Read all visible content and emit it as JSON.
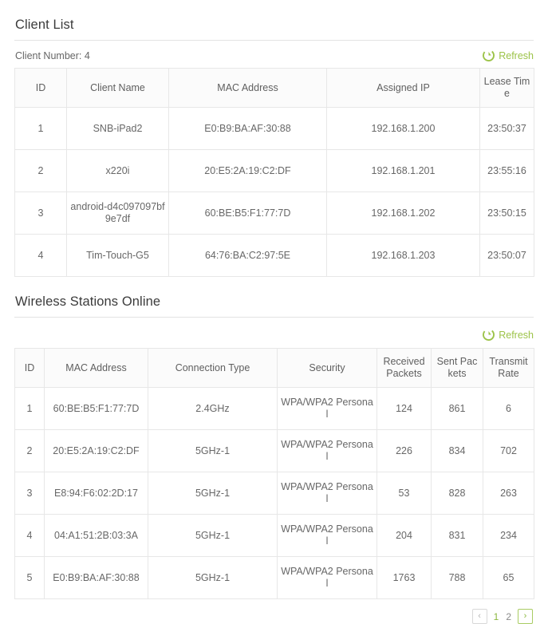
{
  "theme": {
    "accent_green": "#9cc348",
    "border_gray": "#e7e7e7",
    "header_bg": "#fbfbfb",
    "text_gray": "#676767"
  },
  "client_list": {
    "title": "Client List",
    "count_label": "Client Number: 4",
    "refresh_label": "Refresh",
    "refresh_icon": "refresh-circle-arrow-icon",
    "columns": [
      "ID",
      "Client Name",
      "MAC Address",
      "Assigned IP",
      "Lease Time"
    ],
    "rows": [
      [
        "1",
        "SNB-iPad2",
        "E0:B9:BA:AF:30:88",
        "192.168.1.200",
        "23:50:37"
      ],
      [
        "2",
        "x220i",
        "20:E5:2A:19:C2:DF",
        "192.168.1.201",
        "23:55:16"
      ],
      [
        "3",
        "android-d4c097097bf9e7df",
        "60:BE:B5:F1:77:7D",
        "192.168.1.202",
        "23:50:15"
      ],
      [
        "4",
        "Tim-Touch-G5",
        "64:76:BA:C2:97:5E",
        "192.168.1.203",
        "23:50:07"
      ]
    ]
  },
  "wireless_stations": {
    "title": "Wireless Stations Online",
    "refresh_label": "Refresh",
    "refresh_icon": "refresh-circle-arrow-icon",
    "columns": [
      "ID",
      "MAC Address",
      "Connection Type",
      "Security",
      "Received Packets",
      "Sent Packets",
      "Transmit Rate"
    ],
    "rows": [
      [
        "1",
        "60:BE:B5:F1:77:7D",
        "2.4GHz",
        "WPA/WPA2 Personal",
        "124",
        "861",
        "6"
      ],
      [
        "2",
        "20:E5:2A:19:C2:DF",
        "5GHz-1",
        "WPA/WPA2 Personal",
        "226",
        "834",
        "702"
      ],
      [
        "3",
        "E8:94:F6:02:2D:17",
        "5GHz-1",
        "WPA/WPA2 Personal",
        "53",
        "828",
        "263"
      ],
      [
        "4",
        "04:A1:51:2B:03:3A",
        "5GHz-1",
        "WPA/WPA2 Personal",
        "204",
        "831",
        "234"
      ],
      [
        "5",
        "E0:B9:BA:AF:30:88",
        "5GHz-1",
        "WPA/WPA2 Personal",
        "1763",
        "788",
        "65"
      ]
    ],
    "pagination": {
      "prev_glyph": "‹",
      "next_glyph": "›",
      "pages": [
        "1",
        "2"
      ],
      "current_page": "1"
    }
  }
}
